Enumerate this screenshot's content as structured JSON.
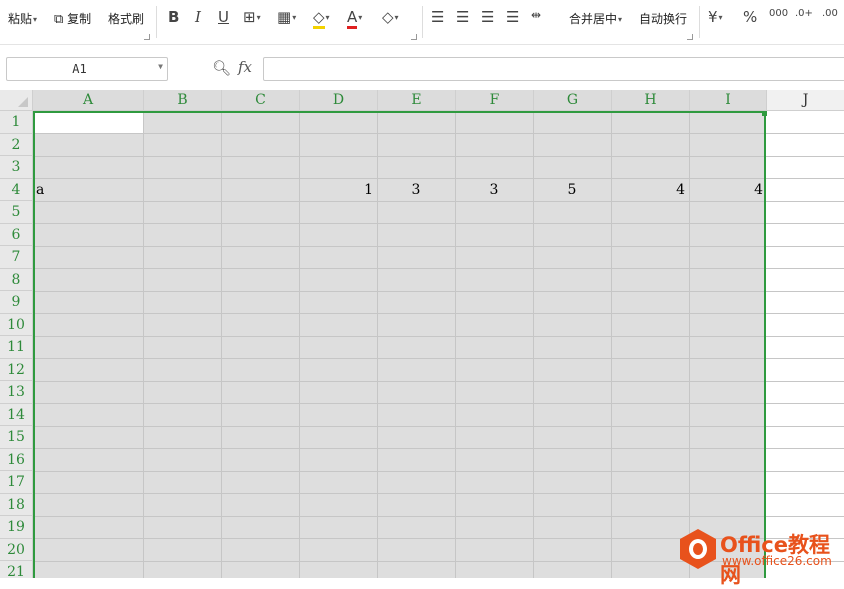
{
  "toolbar": {
    "paste": "粘贴",
    "copy": "复制",
    "format_painter": "格式刷",
    "bold": "B",
    "italic": "I",
    "underline": "U",
    "merge_center": "合并居中",
    "wrap_text": "自动换行"
  },
  "formula_bar": {
    "name_box": "A1",
    "fx": "fx",
    "formula": ""
  },
  "sheet": {
    "columns": [
      "A",
      "B",
      "C",
      "D",
      "E",
      "F",
      "G",
      "H",
      "I",
      "J"
    ],
    "rows": [
      "1",
      "2",
      "3",
      "4",
      "5",
      "6",
      "7",
      "8",
      "9",
      "10",
      "11",
      "12",
      "13",
      "14",
      "15",
      "16",
      "17",
      "18",
      "19",
      "20",
      "21"
    ],
    "row4": {
      "A": "a",
      "D": "1",
      "E": "3",
      "F": "3",
      "G": "5",
      "H": "4",
      "I": "4"
    }
  },
  "colors": {
    "selection_border": "#2f9a3f",
    "header_text": "#2e8a3a",
    "selection_fill": "#dedede",
    "brand": "#e8521c"
  },
  "watermark": {
    "brand": "Office教程网",
    "url": "www.office26.com"
  }
}
